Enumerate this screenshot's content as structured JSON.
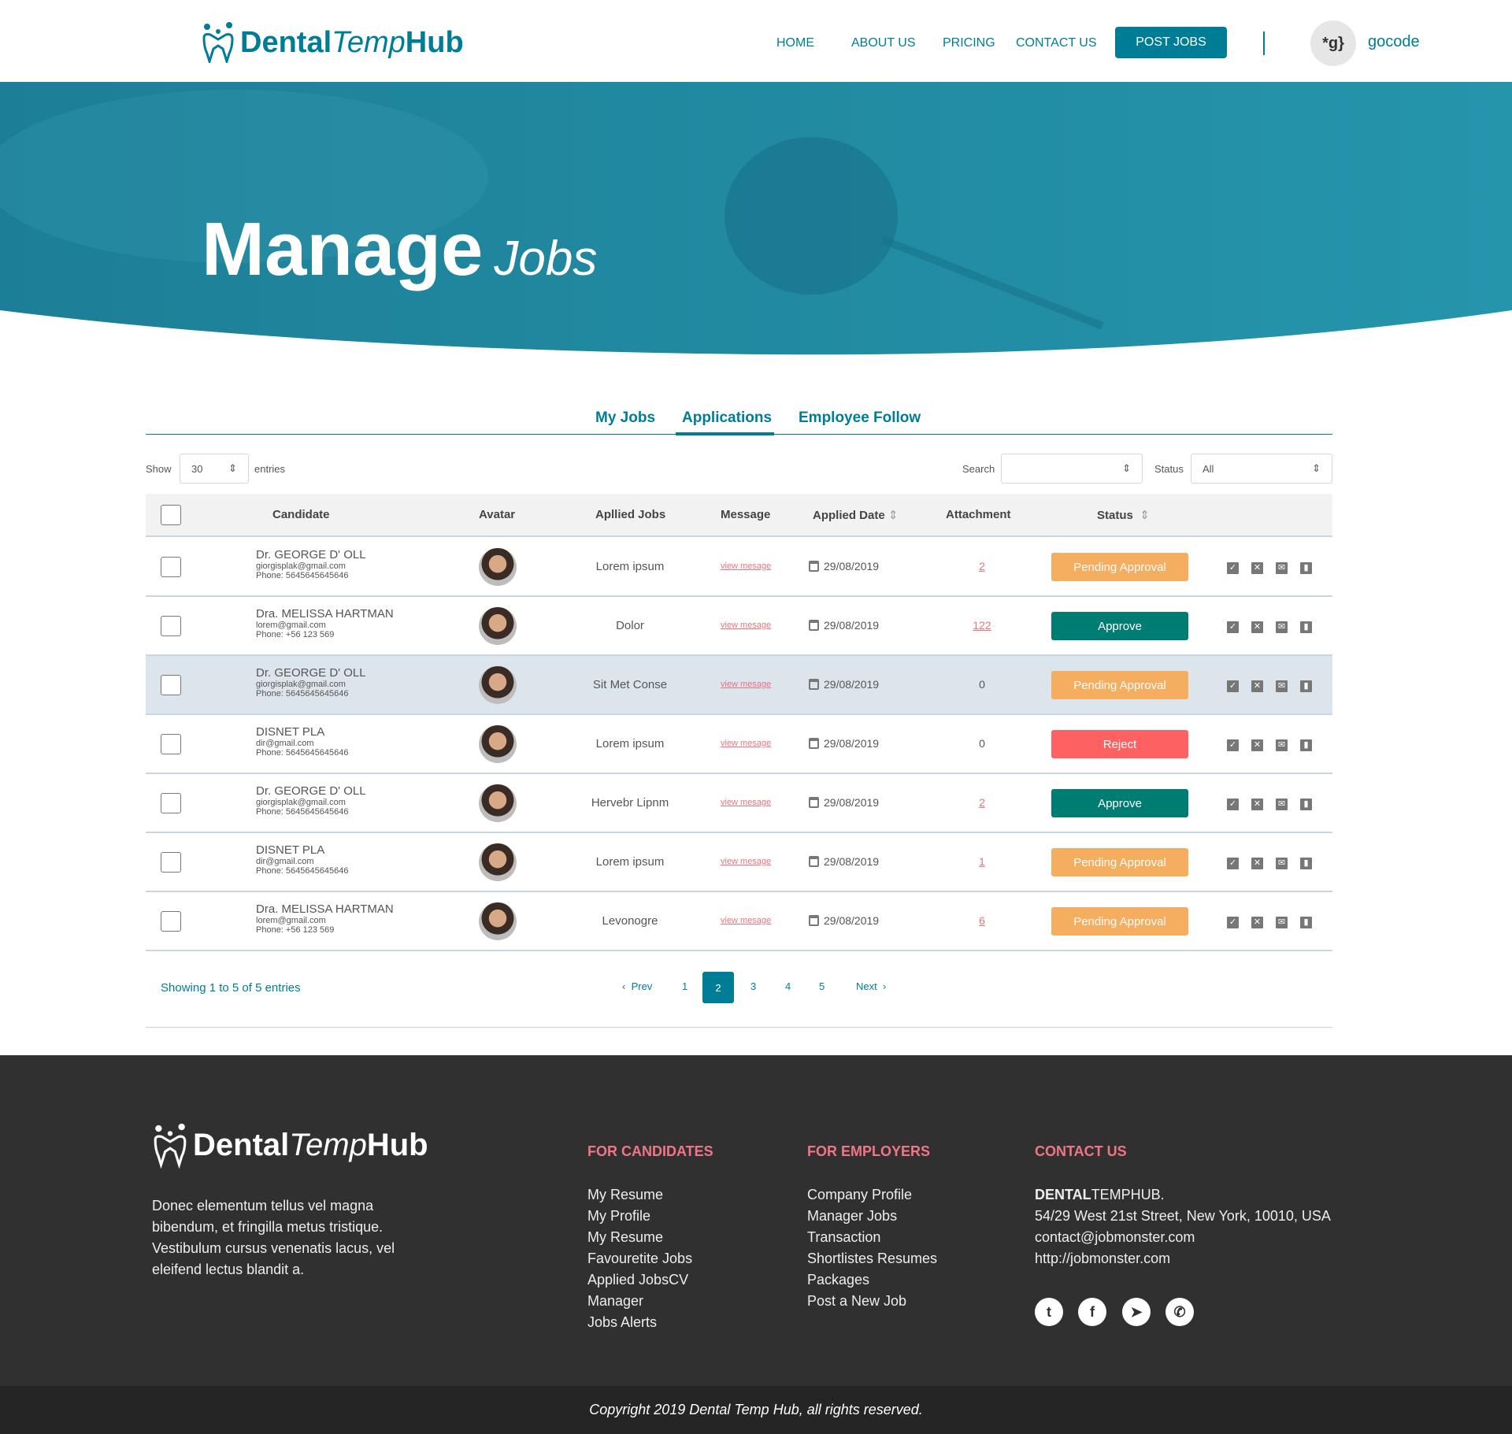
{
  "header": {
    "logo_a": "Dental",
    "logo_b": "Temp",
    "logo_c": "Hub",
    "nav": [
      "HOME",
      "ABOUT US",
      "PRICING",
      "CONTACT US"
    ],
    "post_jobs": "POST JOBS",
    "user_logo": "*g}",
    "user_name": "gocode"
  },
  "hero": {
    "title_a": "Manage",
    "title_b": "Jobs"
  },
  "tabs": [
    "My Jobs",
    "Applications",
    "Employee Follow"
  ],
  "active_tab": "Applications",
  "controls": {
    "show_label": "Show",
    "show_value": "30",
    "entries_label": "entries",
    "search_label": "Search",
    "search_value": "",
    "status_label": "Status",
    "status_value": "All"
  },
  "table": {
    "headers": [
      "Candidate",
      "Avatar",
      "Apllied Jobs",
      "Message",
      "Applied  Date",
      "Attachment",
      "Status"
    ],
    "rows": [
      {
        "name": "Dr. GEORGE D' OLL",
        "email": "giorgisplak@gmail.com",
        "phone": "Phone: 5645645645646",
        "job": "Lorem ipsum",
        "message": "view mesage",
        "date": "29/08/2019",
        "attachment": "2",
        "status": "Pending Approval"
      },
      {
        "name": "Dra. MELISSA HARTMAN",
        "email": "lorem@gmail.com",
        "phone": "Phone: +56 123 569",
        "job": "Dolor",
        "message": "view mesage",
        "date": "29/08/2019",
        "attachment": "122",
        "status": "Approve"
      },
      {
        "name": "Dr. GEORGE D' OLL",
        "email": "giorgisplak@gmail.com",
        "phone": "Phone: 5645645645646",
        "job": "Sit Met Conse",
        "message": "view mesage",
        "date": "29/08/2019",
        "attachment": "0",
        "status": "Pending Approval"
      },
      {
        "name": "DISNET PLA",
        "email": "dir@gmail.com",
        "phone": "Phone: 5645645645646",
        "job": "Lorem ipsum",
        "message": "view mesage",
        "date": "29/08/2019",
        "attachment": "0",
        "status": "Reject"
      },
      {
        "name": "Dr. GEORGE D' OLL",
        "email": "giorgisplak@gmail.com",
        "phone": "Phone: 5645645645646",
        "job": "Hervebr Lipnm",
        "message": "view mesage",
        "date": "29/08/2019",
        "attachment": "2",
        "status": "Approve"
      },
      {
        "name": "DISNET PLA",
        "email": "dir@gmail.com",
        "phone": "Phone: 5645645645646",
        "job": "Lorem ipsum",
        "message": "view mesage",
        "date": "29/08/2019",
        "attachment": "1",
        "status": "Pending Approval"
      },
      {
        "name": "Dra. MELISSA HARTMAN",
        "email": "lorem@gmail.com",
        "phone": "Phone: +56 123 569",
        "job": "Levonogre",
        "message": "view mesage",
        "date": "29/08/2019",
        "attachment": "6",
        "status": "Pending Approval"
      }
    ],
    "highlighted_row": 3,
    "row_actions": [
      "check-square-icon",
      "x-square-icon",
      "envelope-icon",
      "trash-icon"
    ]
  },
  "pagination": {
    "info": "Showing 1 to 5 of 5 entries",
    "prev": "Prev",
    "pages": [
      "1",
      "2",
      "3",
      "4",
      "5"
    ],
    "current": "2",
    "next": "Next"
  },
  "footer": {
    "about": "Donec elementum tellus vel magna bibendum, et fringilla metus tristique. Vestibulum cursus venenatis lacus, vel eleifend lectus blandit a.",
    "candidates_title": "FOR CANDIDATES",
    "candidates": [
      "My Resume",
      "My Profile",
      "My Resume",
      "Favouretite Jobs",
      "Applied JobsCV",
      "Manager",
      "Jobs Alerts"
    ],
    "employers_title": "FOR EMPLOYERS",
    "employers": [
      "Company Profile",
      "Manager Jobs",
      "Transaction",
      "Shortlistes Resumes",
      "Packages",
      "Post a New Job"
    ],
    "contact_title": "CONTACT US",
    "contact_brand_a": "DENTAL",
    "contact_brand_b": "TEMPHUB.",
    "contact": [
      "54/29 West 21st Street, New York, 10010, USA",
      "contact@jobmonster.com",
      "http://jobmonster.com"
    ],
    "social": [
      "twitter-icon",
      "facebook-icon",
      "telegram-icon",
      "whatsapp-icon"
    ],
    "copyright": "Copyright 2019 Dental Temp Hub, all rights reserved."
  },
  "colors": {
    "primary": "#007d96",
    "pending": "#f5ad60",
    "approve": "#007d72",
    "reject": "#fe6161",
    "link": "#e8737f",
    "footer": "#303030"
  }
}
